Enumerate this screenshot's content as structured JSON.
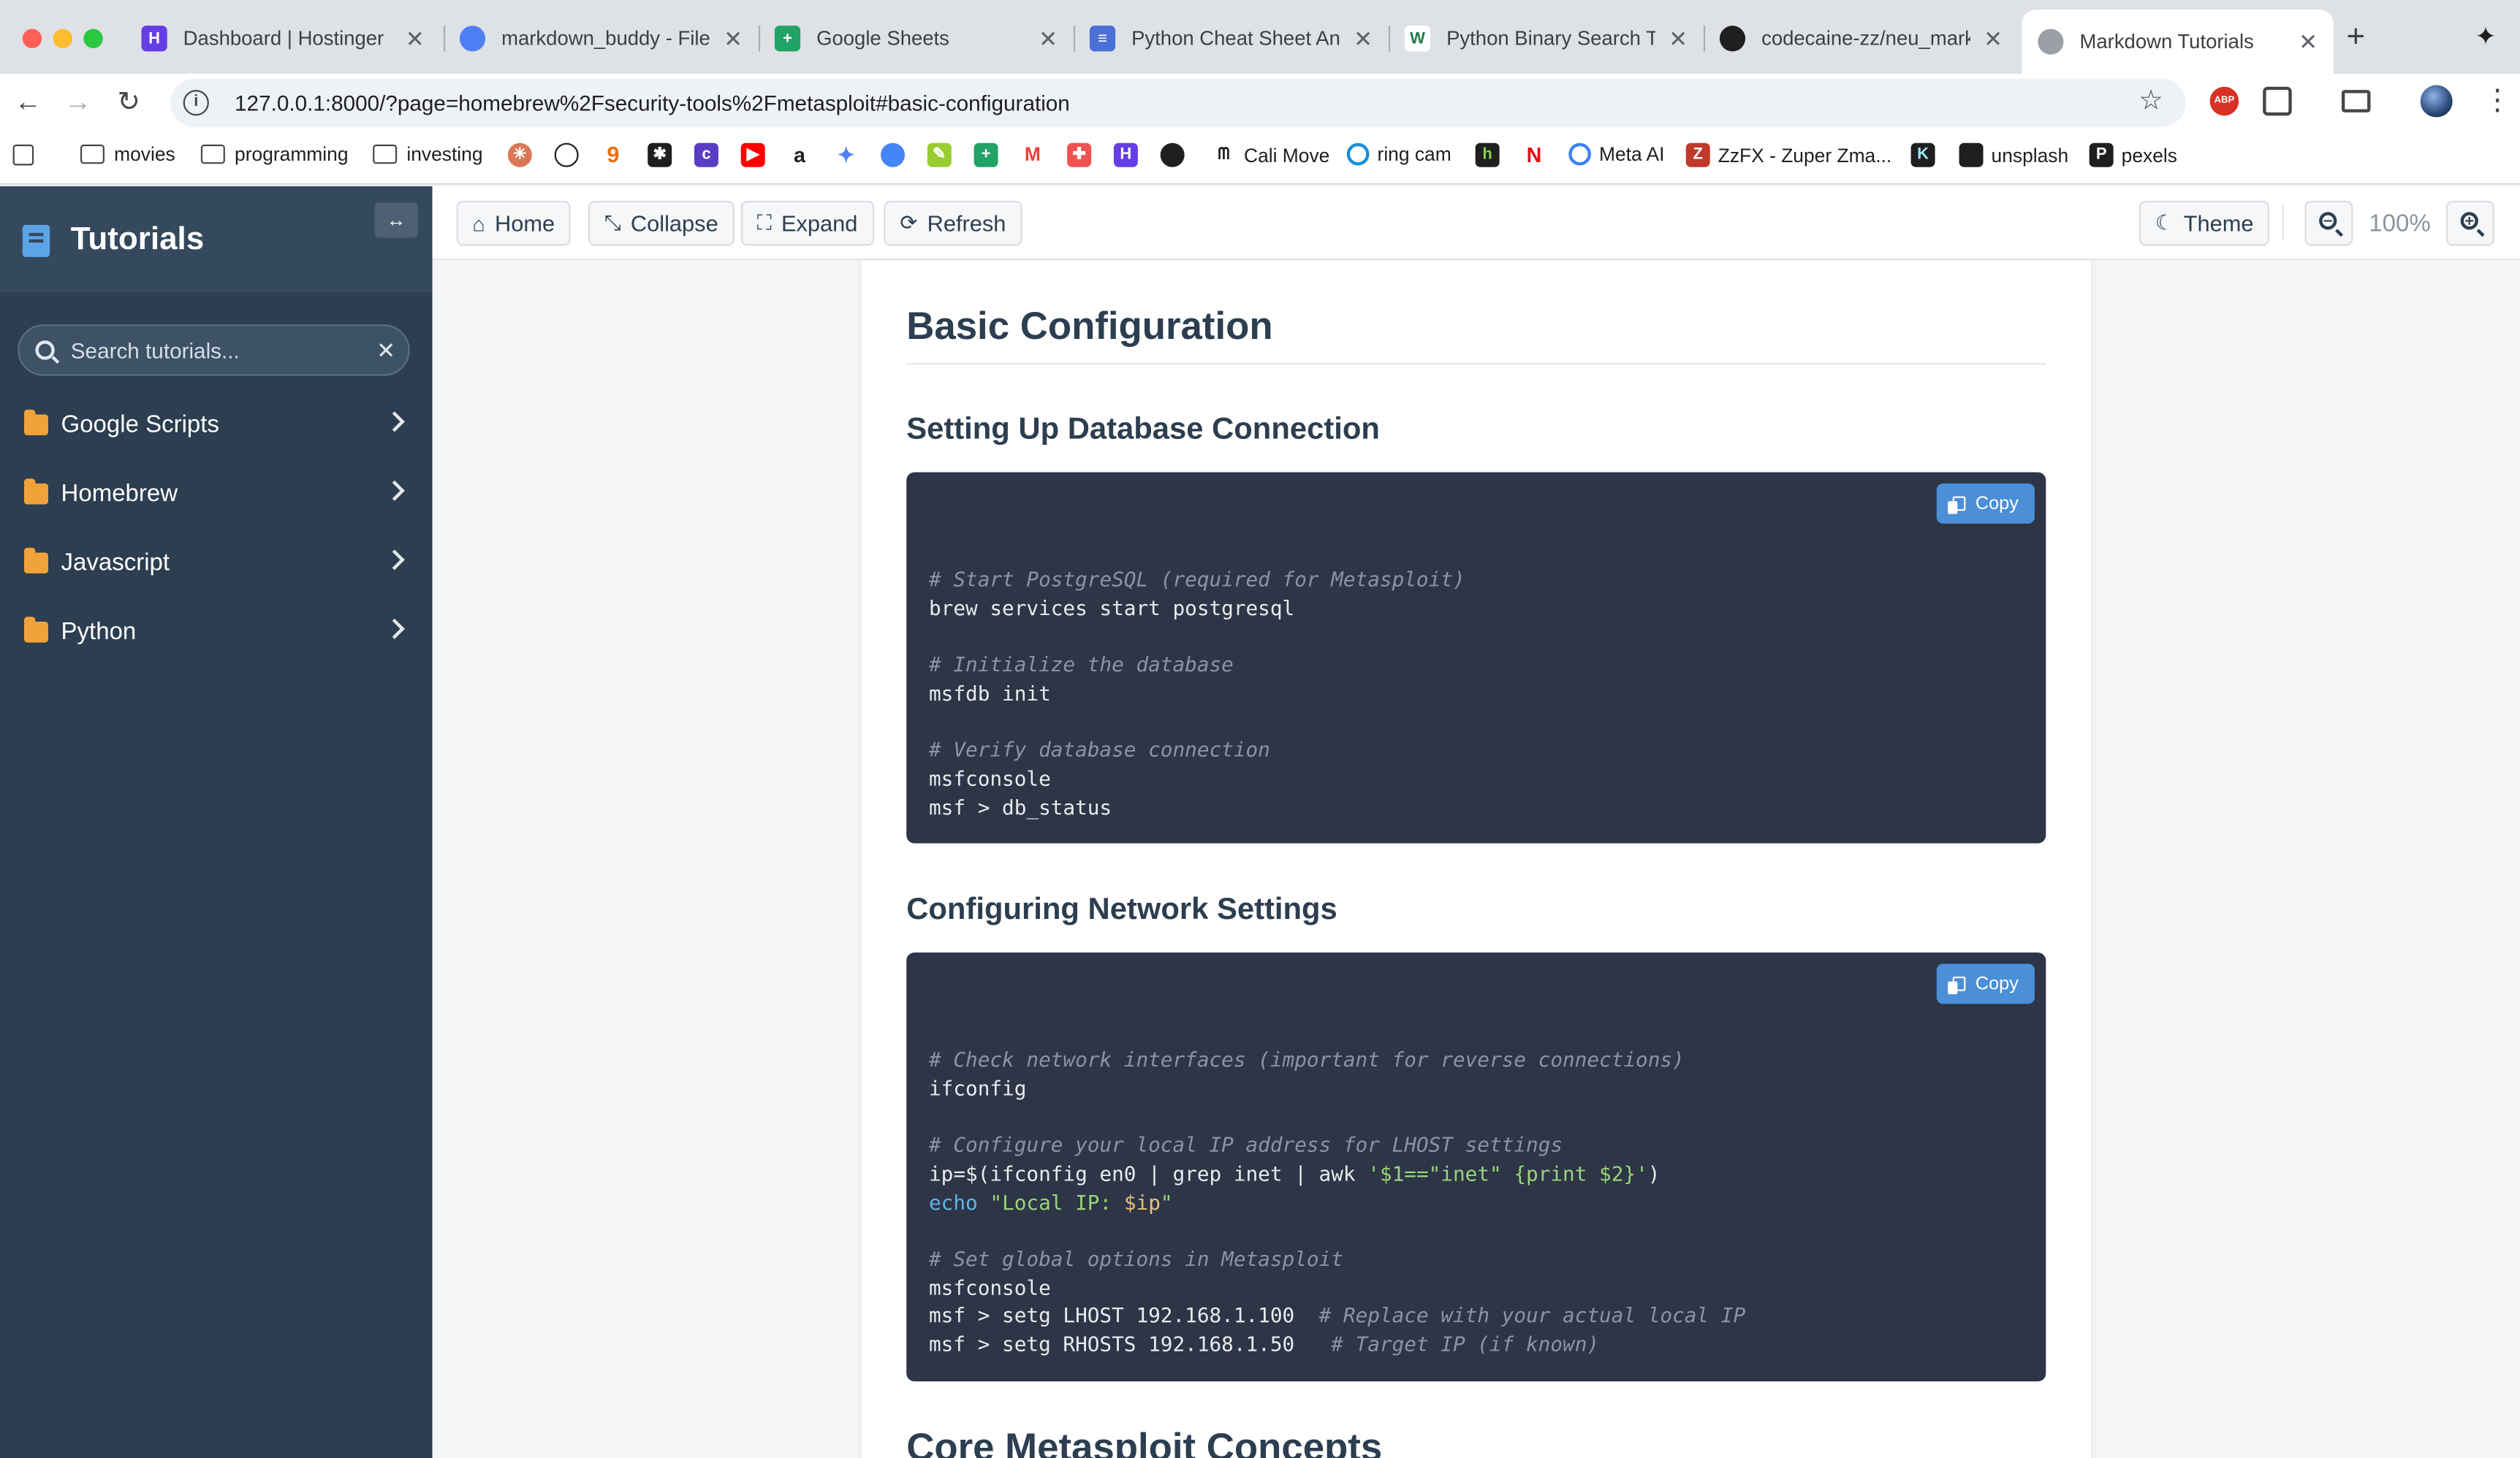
{
  "browser": {
    "tabs": [
      {
        "title": "Dashboard | Hostinger",
        "icon": "hostinger-icon",
        "color": "#673de6"
      },
      {
        "title": "markdown_buddy - Files",
        "icon": "globe-icon",
        "color": "#4f7ff5"
      },
      {
        "title": "Google Sheets",
        "icon": "sheets-icon",
        "color": "#21a366"
      },
      {
        "title": "Python Cheat Sheet And",
        "icon": "doc-icon",
        "color": "#4a6fd8"
      },
      {
        "title": "Python Binary Search Tre",
        "icon": "w-icon",
        "color": "#1f7a4d"
      },
      {
        "title": "codecaine-zz/neu_markd",
        "icon": "github-icon",
        "color": "#1f1f1f"
      },
      {
        "title": "Markdown Tutorials",
        "icon": "globe-icon",
        "color": "#5f6368"
      }
    ],
    "url": "127.0.0.1:8000/?page=homebrew%2Fsecurity-tools%2Fmetasploit#basic-configuration",
    "bookmarks": {
      "movies": "movies",
      "programming": "programming",
      "investing": "investing",
      "cali_move": "Cali Move",
      "ring_cam": "ring cam",
      "meta_ai": "Meta AI",
      "zzfx": "ZzFX - Zuper Zma...",
      "unsplash": "unsplash",
      "pexels": "pexels"
    }
  },
  "sidebar": {
    "title": "Tutorials",
    "search_placeholder": "Search tutorials...",
    "items": [
      {
        "label": "Google Scripts"
      },
      {
        "label": "Homebrew"
      },
      {
        "label": "Javascript"
      },
      {
        "label": "Python"
      }
    ]
  },
  "toolbar": {
    "home": "Home",
    "collapse": "Collapse",
    "expand": "Expand",
    "refresh": "Refresh",
    "theme": "Theme",
    "zoom": "100%"
  },
  "article": {
    "h2_basic": "Basic Configuration",
    "h3_db": "Setting Up Database Connection",
    "h3_net": "Configuring Network Settings",
    "h2_core": "Core Metasploit Concepts",
    "copy_label": "Copy",
    "code_db": [
      {
        "type": "comment",
        "text": "# Start PostgreSQL (required for Metasploit)"
      },
      {
        "type": "code",
        "text": "brew services start postgresql"
      },
      {
        "type": "blank",
        "text": ""
      },
      {
        "type": "comment",
        "text": "# Initialize the database"
      },
      {
        "type": "code",
        "text": "msfdb init"
      },
      {
        "type": "blank",
        "text": ""
      },
      {
        "type": "comment",
        "text": "# Verify database connection"
      },
      {
        "type": "code",
        "text": "msfconsole"
      },
      {
        "type": "code",
        "text": "msf > db_status"
      }
    ],
    "code_net": {
      "c1": "# Check network interfaces (important for reverse connections)",
      "l1": "ifconfig",
      "c2": "# Configure your local IP address for LHOST settings",
      "ip_a": "ip=$(ifconfig en0 | grep inet | awk ",
      "ip_str": "'$1==\"inet\" {print $2}'",
      "ip_b": ")",
      "echo_kw": "echo",
      "echo_str": " \"Local IP: ",
      "echo_var": "$ip",
      "echo_end": "\"",
      "c3": "# Set global options in Metasploit",
      "l2": "msfconsole",
      "l3": "msf > setg LHOST 192.168.1.100",
      "l3c": "# Replace with your actual local IP",
      "l4": "msf > setg RHOSTS 192.168.1.50",
      "l4c": "# Target IP (if known)"
    }
  }
}
